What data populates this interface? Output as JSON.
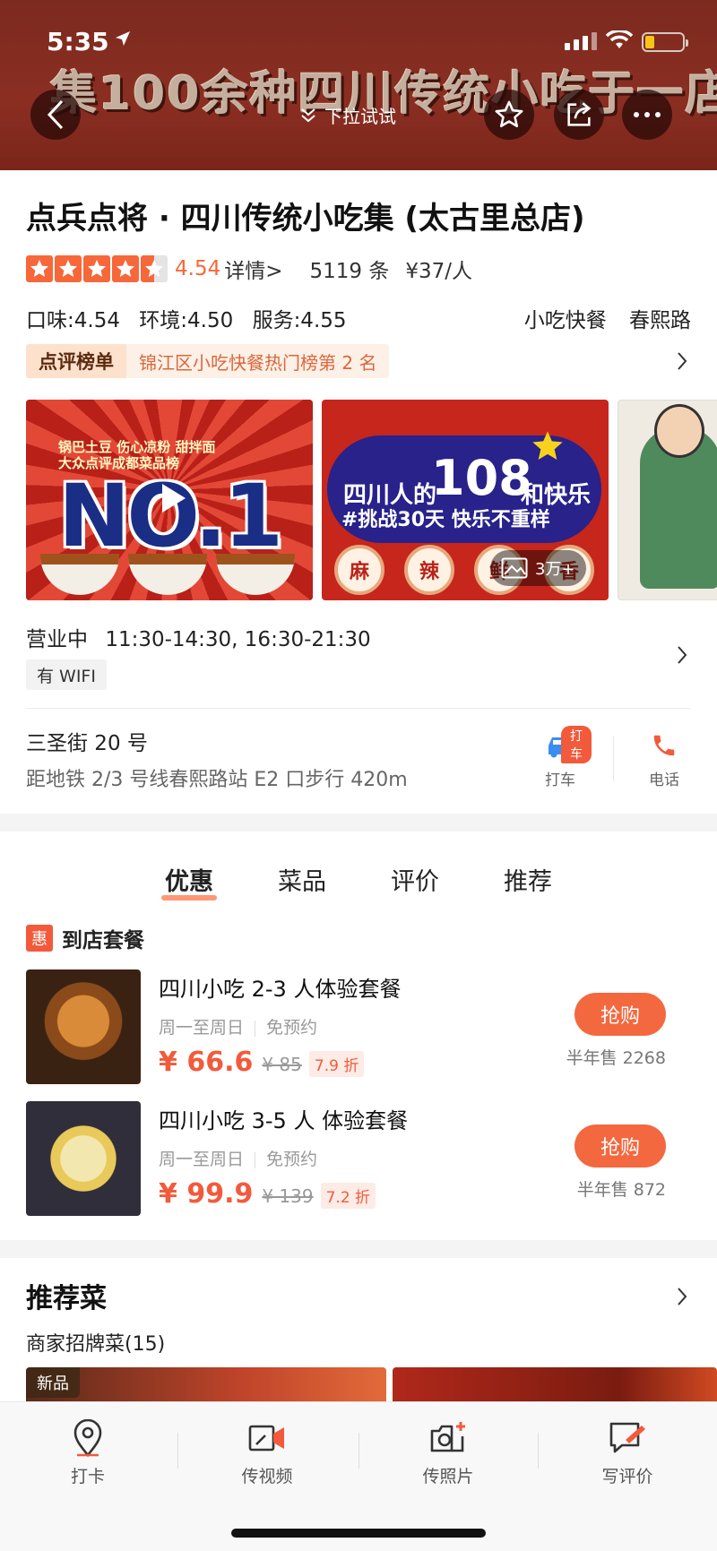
{
  "status_bar": {
    "time": "5:35",
    "battery_color": "#f5c518"
  },
  "banner": {
    "title_text": "集100余种四川传统小吃于一店",
    "pull_hint": "下拉试试",
    "bg_color": "#8b2e22"
  },
  "shop": {
    "name": "点兵点将 · 四川传统小吃集 (太古里总店)",
    "rating_stars": 4.5,
    "score": "4.54",
    "detail_link": "详情>",
    "review_count": "5119 条",
    "avg_price": "¥37/人",
    "sub_scores": {
      "taste": "口味:4.54",
      "env": "环境:4.50",
      "service": "服务:4.55"
    },
    "tags": {
      "category": "小吃快餐",
      "area": "春熙路"
    },
    "rank": {
      "badge": "点评榜单",
      "text": "锦江区小吃快餐热门榜第 2 名"
    }
  },
  "gallery": {
    "img1": {
      "tagline_1": "锅巴土豆 伤心凉粉 甜拌面",
      "tagline_2": "大众点评成都菜品榜",
      "big_text": "NO.1"
    },
    "img2": {
      "line1": "四川人的",
      "number": "108",
      "line1b": "和快乐",
      "line2": "#挑战30天 快乐不重样",
      "coins": [
        "麻",
        "辣",
        "鲜",
        "香"
      ]
    },
    "photo_count": "3万+"
  },
  "hours": {
    "status": "营业中",
    "times": "11:30-14:30, 16:30-21:30",
    "wifi_tag": "有 WIFI"
  },
  "address": {
    "street": "三圣街 20 号",
    "transit": "距地铁 2/3 号线春熙路站 E2 口步行 420m",
    "taxi_label": "打车",
    "taxi_badge": "打车",
    "phone_label": "电话"
  },
  "tabs": [
    {
      "label": "优惠",
      "active": true
    },
    {
      "label": "菜品",
      "active": false
    },
    {
      "label": "评价",
      "active": false
    },
    {
      "label": "推荐",
      "active": false
    }
  ],
  "deals": {
    "section_icon": "惠",
    "section_title": "到店套餐",
    "items": [
      {
        "name": "四川小吃 2-3 人体验套餐",
        "days": "周一至周日",
        "reserve": "免预约",
        "price": "¥ 66.6",
        "original": "¥ 85",
        "discount": "7.9 折",
        "button": "抢购",
        "sold": "半年售 2268"
      },
      {
        "name": "四川小吃  3-5 人 体验套餐",
        "days": "周一至周日",
        "reserve": "免预约",
        "price": "¥ 99.9",
        "original": "¥ 139",
        "discount": "7.2 折",
        "button": "抢购",
        "sold": "半年售 872"
      }
    ]
  },
  "recommended": {
    "title": "推荐菜",
    "subtitle": "商家招牌菜(15)",
    "new_tag": "新品"
  },
  "bottom_bar": [
    {
      "label": "打卡",
      "icon": "location-pin-icon"
    },
    {
      "label": "传视频",
      "icon": "video-upload-icon"
    },
    {
      "label": "传照片",
      "icon": "camera-add-icon"
    },
    {
      "label": "写评价",
      "icon": "write-review-icon"
    }
  ],
  "colors": {
    "accent": "#f25a3b",
    "star": "#f6683a"
  }
}
